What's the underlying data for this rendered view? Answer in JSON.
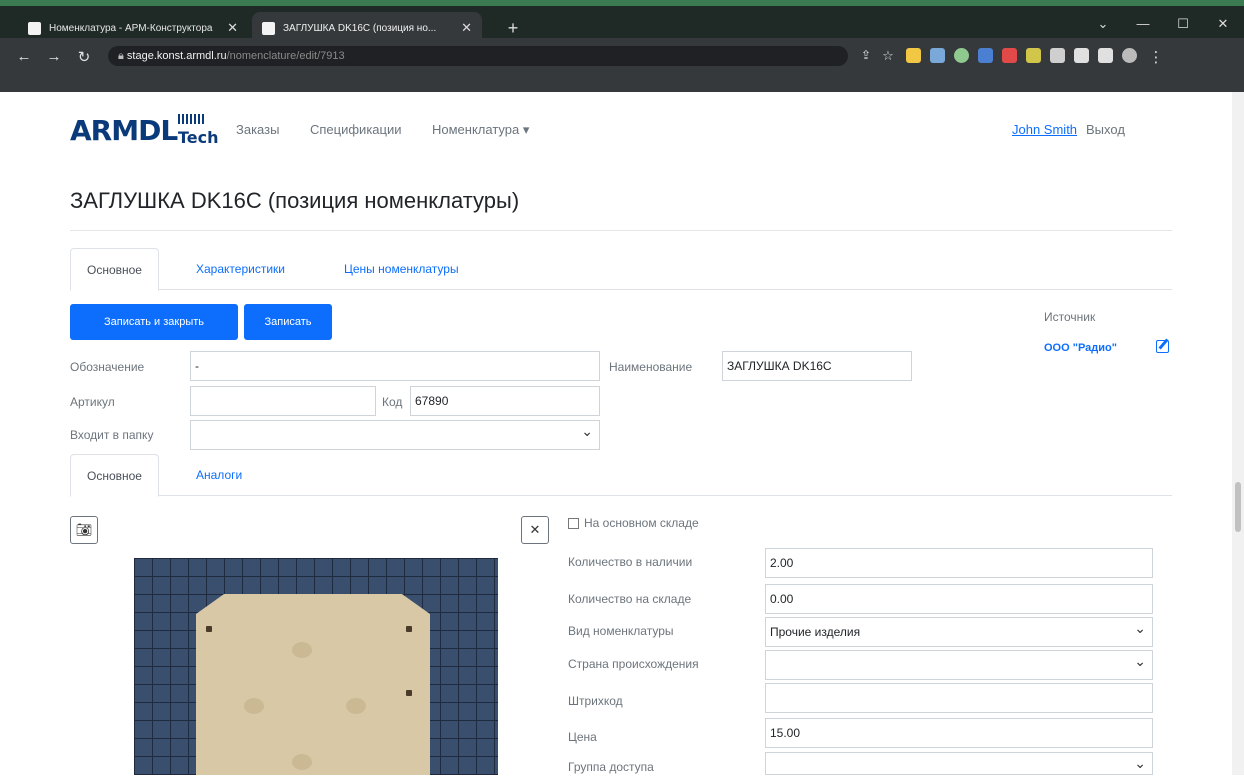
{
  "browser": {
    "tabs": [
      {
        "title": "Номенклатура - АРМ-Конструктора"
      },
      {
        "title": "ЗАГЛУШКА DK16C (позиция но..."
      }
    ],
    "url_host": "stage.konst.armdl.ru",
    "url_path": "/nomenclature/edit/7913"
  },
  "nav": {
    "logo_text": "ARMDL",
    "logo_sub": "Tech",
    "links": [
      "Заказы",
      "Спецификации",
      "Номенклатура ▾"
    ],
    "user": "John Smith",
    "logout": "Выход"
  },
  "page": {
    "title": "ЗАГЛУШКА DK16C (позиция номенклатуры)",
    "tabs": [
      "Основное",
      "Характеристики",
      "Цены номенклатуры"
    ],
    "buttons": {
      "save_close": "Записать и закрыть",
      "save": "Записать"
    },
    "source": {
      "label": "Источник",
      "value": "ООО \"Радио\""
    },
    "form": {
      "designation_label": "Обозначение",
      "designation_value": "-",
      "name_label": "Наименование",
      "name_value": "ЗАГЛУШКА DK16C",
      "article_label": "Артикул",
      "article_value": "",
      "code_label": "Код",
      "code_value": "67890",
      "folder_label": "Входит в папку",
      "folder_value": ""
    },
    "subtabs": [
      "Основное",
      "Аналоги"
    ],
    "details": {
      "main_warehouse_label": "На основном складе",
      "main_warehouse_checked": false,
      "rows": [
        {
          "label": "Количество в наличии",
          "value": "2.00",
          "type": "input"
        },
        {
          "label": "Количество на складе",
          "value": "0.00",
          "type": "input"
        },
        {
          "label": "Вид номенклатуры",
          "value": "Прочие изделия",
          "type": "select"
        },
        {
          "label": "Страна происхождения",
          "value": "",
          "type": "select"
        },
        {
          "label": "Штрихкод",
          "value": "",
          "type": "input"
        },
        {
          "label": "Цена",
          "value": "15.00",
          "type": "input"
        },
        {
          "label": "Группа доступа",
          "value": "",
          "type": "select"
        }
      ]
    }
  }
}
